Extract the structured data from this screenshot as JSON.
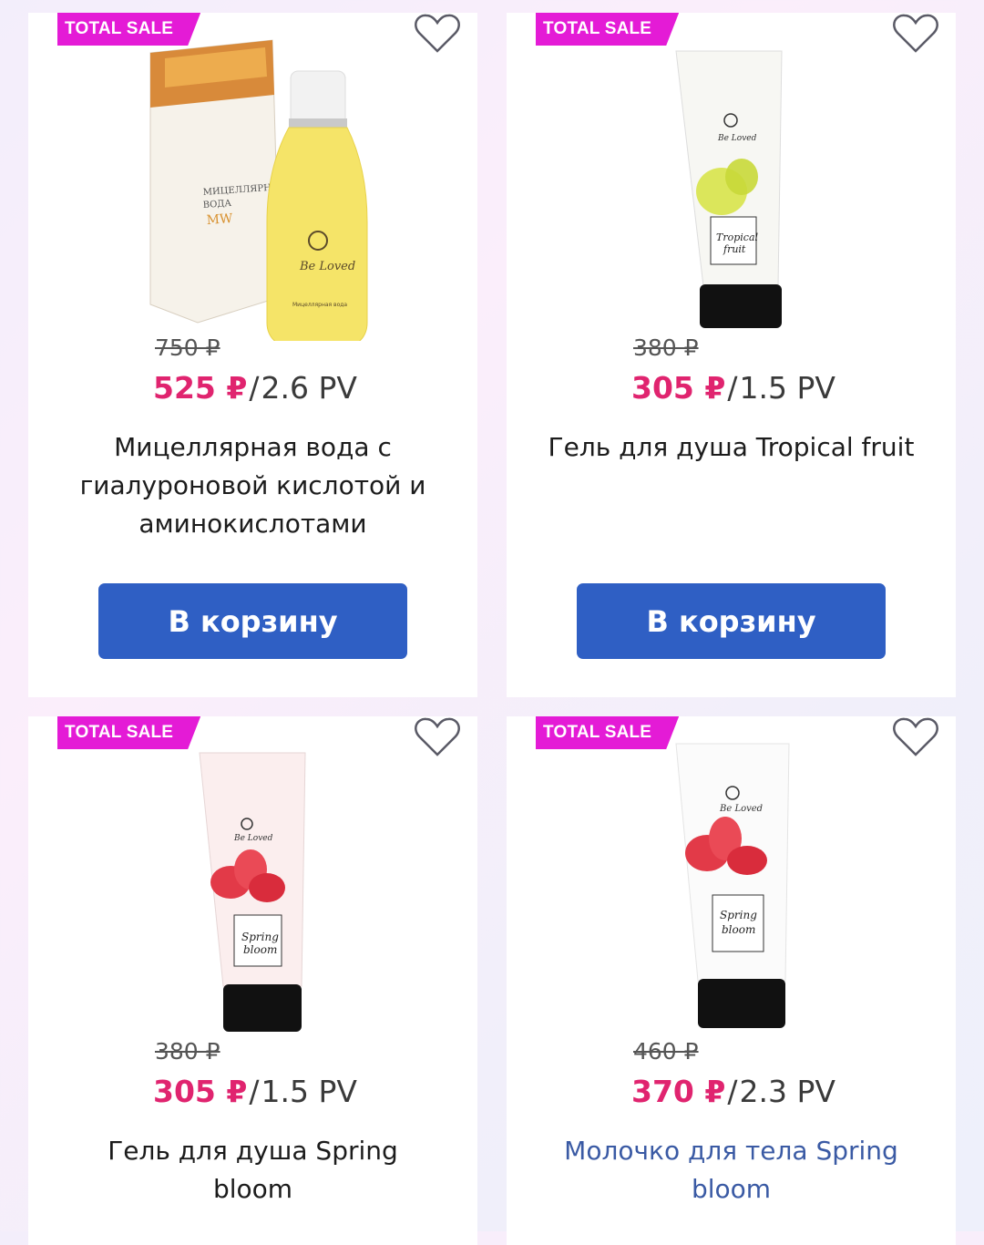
{
  "products": [
    {
      "badge": "TOTAL SALE",
      "old_price": "750 ₽",
      "new_price": "525 ₽",
      "pv": "2.6 PV",
      "title": "Мицеллярная вода с гиалуроновой кислотой и аминокислотами",
      "button": "В корзину",
      "image_icon": "micellar-water-bottle-and-box"
    },
    {
      "badge": "TOTAL SALE",
      "old_price": "380 ₽",
      "new_price": "305 ₽",
      "pv": "1.5 PV",
      "title": "Гель для душа Tropical fruit",
      "button": "В корзину",
      "image_icon": "shower-gel-tube-tropical"
    },
    {
      "badge": "TOTAL SALE",
      "old_price": "380 ₽",
      "new_price": "305 ₽",
      "pv": "1.5 PV",
      "title": "Гель для душа Spring bloom",
      "image_icon": "shower-gel-tube-spring-bloom"
    },
    {
      "badge": "TOTAL SALE",
      "old_price": "460 ₽",
      "new_price": "370 ₽",
      "pv": "2.3 PV",
      "title": "Молочко для тела Spring bloom",
      "image_icon": "body-lotion-tube-spring-bloom"
    }
  ],
  "colors": {
    "badge": "#e41bd6",
    "new_price": "#e0246f",
    "button": "#2f5fc4",
    "link_title": "#3a5aa4"
  }
}
